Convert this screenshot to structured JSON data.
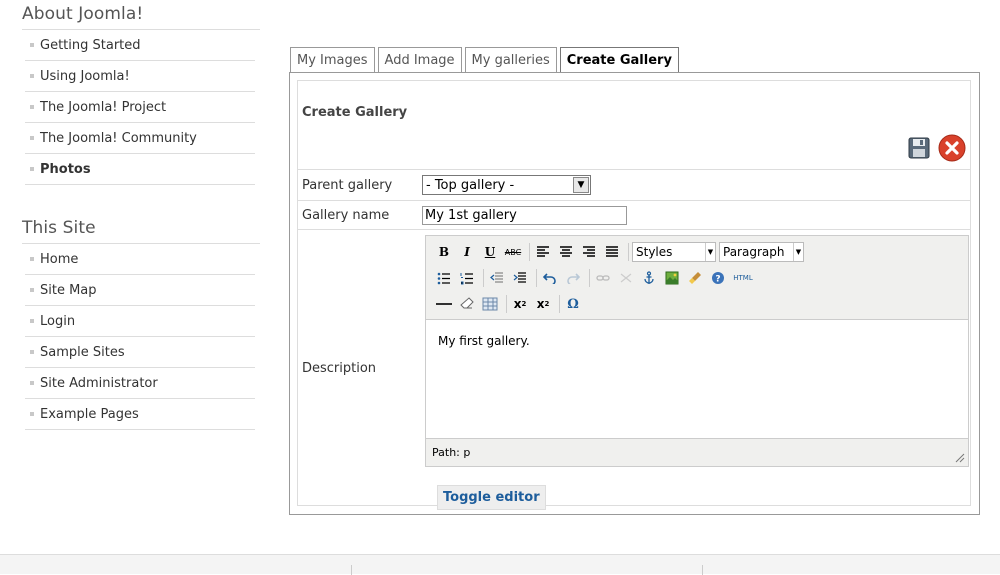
{
  "sidebar": {
    "about": {
      "title": "About Joomla!",
      "items": [
        {
          "label": "Getting Started"
        },
        {
          "label": "Using Joomla!"
        },
        {
          "label": "The Joomla! Project"
        },
        {
          "label": "The Joomla! Community"
        },
        {
          "label": "Photos"
        }
      ]
    },
    "site": {
      "title": "This Site",
      "items": [
        {
          "label": "Home"
        },
        {
          "label": "Site Map"
        },
        {
          "label": "Login"
        },
        {
          "label": "Sample Sites"
        },
        {
          "label": "Site Administrator"
        },
        {
          "label": "Example Pages"
        }
      ]
    }
  },
  "tabs": [
    {
      "label": "My Images"
    },
    {
      "label": "Add Image"
    },
    {
      "label": "My galleries"
    },
    {
      "label": "Create Gallery"
    }
  ],
  "form": {
    "title": "Create Gallery",
    "parent_label": "Parent gallery",
    "parent_value": "- Top gallery -",
    "name_label": "Gallery name",
    "name_value": "My 1st gallery",
    "description_label": "Description",
    "toggle_label": "Toggle editor"
  },
  "editor": {
    "styles_value": "Styles",
    "format_value": "Paragraph",
    "content": "My first gallery.",
    "path": "Path: p",
    "html_button": "HTML"
  },
  "colors": {
    "accent": "#1d5d9c",
    "cancel": "#d9412b"
  }
}
